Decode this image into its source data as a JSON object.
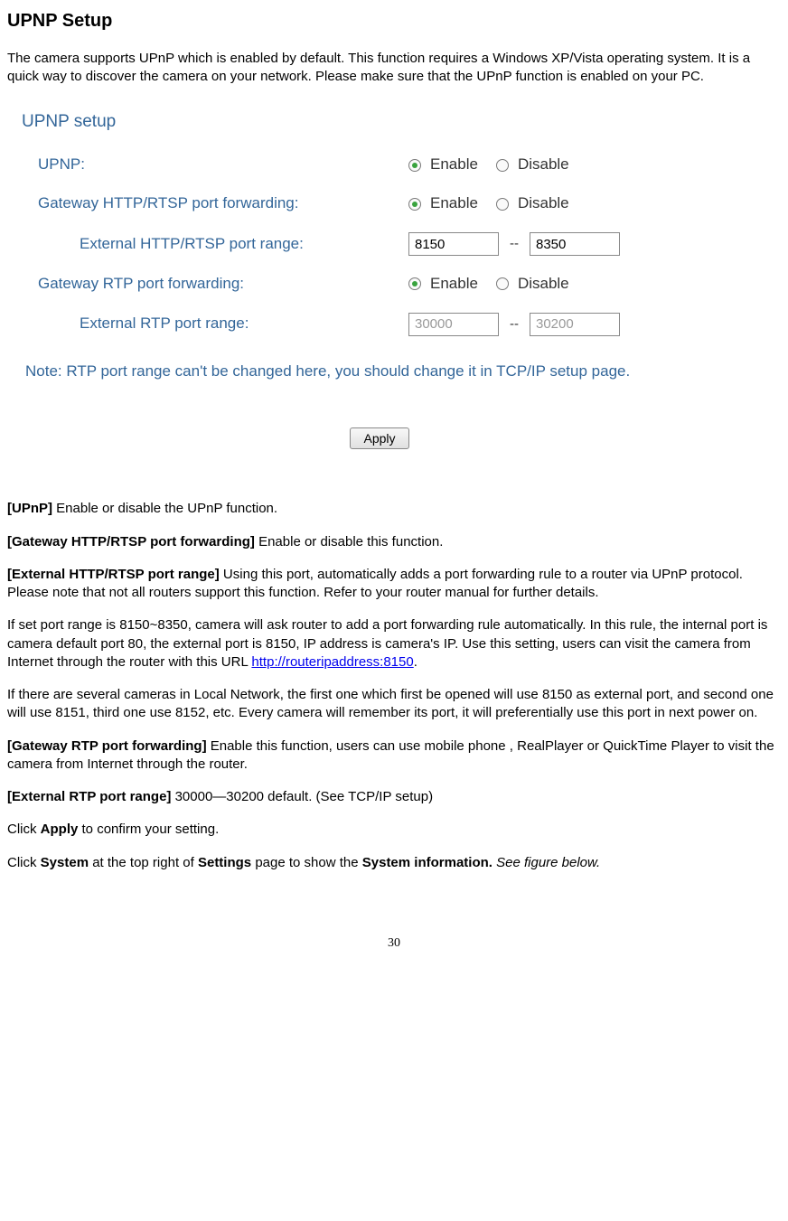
{
  "title": "UPNP Setup",
  "intro": "The camera supports UPnP which is enabled by default. This function requires a Windows XP/Vista operating system. It is a quick way to discover the camera on your network. Please make sure that the UPnP function is enabled on your PC.",
  "form": {
    "heading": "UPNP setup",
    "rows": {
      "upnp": {
        "label": "UPNP:",
        "enable": "Enable",
        "disable": "Disable"
      },
      "gatewayHttp": {
        "label": "Gateway HTTP/RTSP port forwarding:",
        "enable": "Enable",
        "disable": "Disable"
      },
      "extHttp": {
        "label": "External HTTP/RTSP port range:",
        "from": "8150",
        "to": "8350",
        "sep": "--"
      },
      "gatewayRtp": {
        "label": "Gateway RTP port forwarding:",
        "enable": "Enable",
        "disable": "Disable"
      },
      "extRtp": {
        "label": "External RTP port range:",
        "from": "30000",
        "to": "30200",
        "sep": "--"
      }
    },
    "note": "Note: RTP port range can't be changed here, you should change it in TCP/IP setup page.",
    "apply": "Apply"
  },
  "defs": {
    "upnp": {
      "label": "[UPnP]",
      "text": " Enable or disable the UPnP function."
    },
    "gwHttp": {
      "label": "[Gateway HTTP/RTSP port forwarding]",
      "text": " Enable or disable this function."
    },
    "extHttp": {
      "label": "[External HTTP/RTSP port range]",
      "text": " Using this port, automatically adds a port forwarding rule to a router via UPnP protocol. Please note that not all routers support this function. Refer to your router manual for further details."
    },
    "extHttp2a": "If set port range is 8150~8350, camera will ask router to add a port forwarding rule automatically. In this rule, the internal port is camera default port 80, the external port is 8150, IP address is camera's IP. Use this setting, users can visit the camera from Internet through the router with this URL ",
    "extHttp2link": "http://routeripaddress:8150",
    "extHttp2b": ".",
    "extHttp3": "If there are several cameras in Local Network, the first one which first be opened will use 8150 as external port, and second one will use 8151, third one use 8152, etc. Every camera will remember its port, it will preferentially use this port in next power on.",
    "gwRtp": {
      "label": "[Gateway RTP port forwarding]",
      "text": " Enable this function, users can use mobile phone , RealPlayer or QuickTime Player to visit the camera from Internet through the router."
    },
    "extRtp": {
      "label": "[External RTP port range]",
      "text": " 30000—30200 default. (See TCP/IP setup)"
    },
    "clickApply1": "Click ",
    "clickApply2": "Apply",
    "clickApply3": " to confirm your setting.",
    "clickSystem1": "Click ",
    "clickSystem2": "System",
    "clickSystem3": " at the top right of ",
    "clickSystem4": "Settings",
    "clickSystem5": " page to show the ",
    "clickSystem6": "System information.",
    "clickSystem7": " See figure below."
  },
  "pageNumber": "30"
}
